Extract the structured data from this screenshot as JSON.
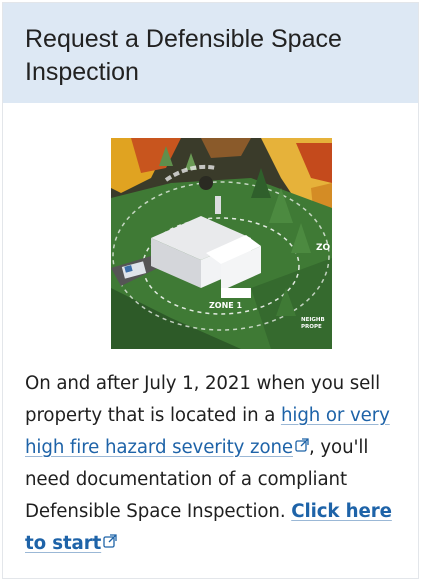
{
  "card": {
    "title": "Request a Defensible Space Inspection",
    "image": {
      "alt_labels": {
        "zone1": "ZONE 1",
        "zone2_partial": "ZO",
        "neighbor_partial_1": "NEIGHB",
        "neighbor_partial_2": "PROPE"
      }
    },
    "body": {
      "text_before_link": "On and after July 1, 2021 when you sell property that is located in a ",
      "fire_zone_link": "high or very high fire hazard severity zone",
      "text_after_link": ", you'll need documentation of a compliant Defensible Space Inspection. ",
      "start_link": "Click here to start"
    },
    "icons": {
      "external_link": "external-link-icon"
    },
    "colors": {
      "header_bg": "#dde8f4",
      "link": "#1e63a8",
      "text": "#1f1f1f"
    }
  }
}
